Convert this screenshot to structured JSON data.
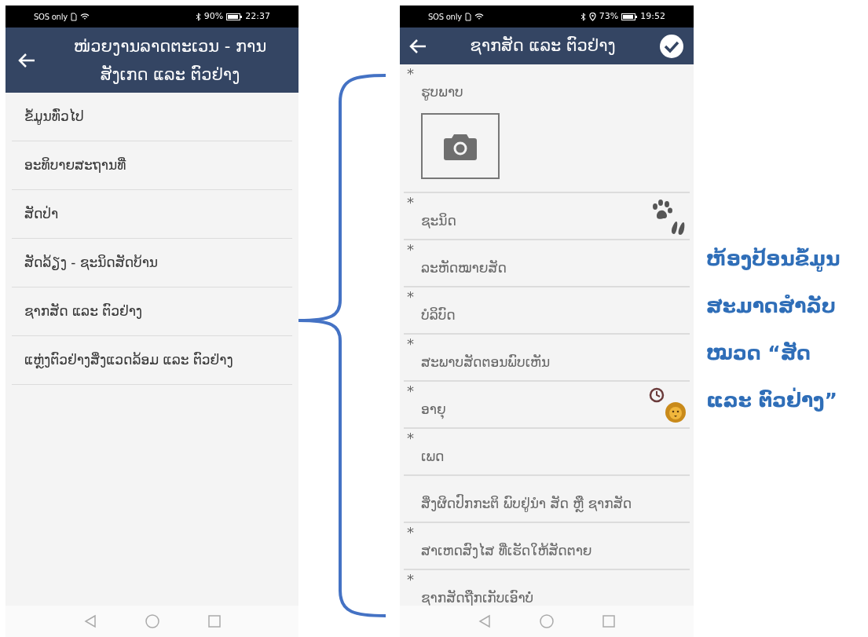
{
  "menu_screen": {
    "status_bar": {
      "network": "SOS only",
      "battery": "90%",
      "time": "22:37"
    },
    "title": "ໜ່ວຍງານລາດຕະເວນ - ການສັງເກດ ແລະ ຕົວຢ່າງ",
    "items": [
      "ຂໍ້ມູນທົ່ວໄປ",
      "ອະທິບາຍສະຖານທີ່",
      "ສັດປ່າ",
      "ສັດລ້ຽງ - ຊະນິດສັດບ້ານ",
      "ຊາກສັດ ແລະ ຕົວຢ່າງ",
      "ແຫຼ່ງຕົວຢ່າງສິ່ງແວດລ້ອມ ແລະ ຕົວຢ່າງ"
    ]
  },
  "form_screen": {
    "status_bar": {
      "network": "SOS only",
      "battery": "73%",
      "time": "19:52"
    },
    "title": "ຊາກສັດ ແລະ ຕົວຢ່າງ",
    "fields": [
      {
        "kind": "photo",
        "marker": "*",
        "label": "ຮູບພາບ"
      },
      {
        "kind": "species",
        "marker": "*",
        "label": "ຊະນິດ"
      },
      {
        "kind": "text",
        "marker": "*",
        "label": "ລະຫັດໝາຍສັດ"
      },
      {
        "kind": "text",
        "marker": "*",
        "label": "ບໍລິບົດ"
      },
      {
        "kind": "text",
        "marker": "*",
        "label": "ສະພາບສັດຕອນພົບເຫັນ"
      },
      {
        "kind": "age",
        "marker": "*",
        "label": "ອາຍຸ"
      },
      {
        "kind": "text",
        "marker": "*",
        "label": "ເພດ"
      },
      {
        "kind": "text",
        "label": "ສິ່ງຜິດປົກກະຕິ ພົບຢູ່ນຳ ສັດ ຫຼື ຊາກສັດ"
      },
      {
        "kind": "text",
        "marker": "*",
        "label": "ສາເຫດສົງໄສ ທີ່ເຮັດໃຫ້ສັດຕາຍ"
      },
      {
        "kind": "text",
        "marker": "*",
        "label": "ຊາກສັດຖືກເກັບເອົາບໍ່"
      }
    ]
  },
  "annotation": "ຫ້ອງປ້ອນຂໍ້ມູນ ສະມາດສຳລັບ ໝວດ “ສັດ ແລະ ຕົວຢ່າງ”"
}
